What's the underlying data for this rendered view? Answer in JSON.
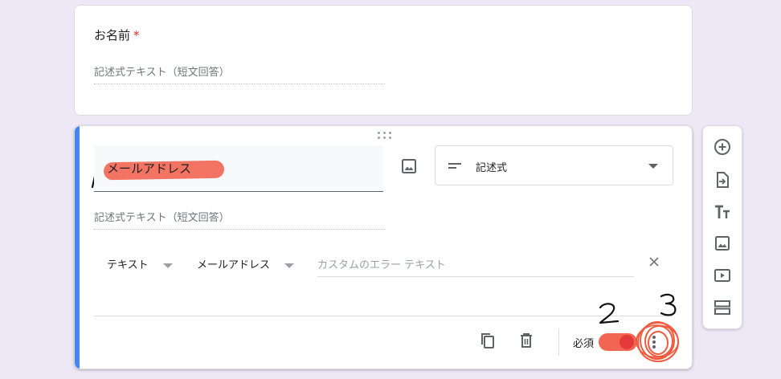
{
  "question1": {
    "title": "お名前",
    "required_mark": "*",
    "answer_placeholder": "記述式テキスト（短文回答）"
  },
  "question2": {
    "title": "メールアドレス",
    "answer_placeholder": "記述式テキスト（短文回答）",
    "type_select": {
      "value": "記述式",
      "icon": "short-text-icon"
    },
    "validation": {
      "type": "テキスト",
      "condition": "メールアドレス",
      "error_placeholder": "カスタムのエラー テキスト"
    },
    "footer": {
      "required_label": "必須",
      "required_on": true
    }
  },
  "annotations": {
    "one": "1",
    "two": "2",
    "three": "3",
    "color": "#f26552"
  },
  "side_toolbar": {
    "items": [
      "add-question-icon",
      "import-questions-icon",
      "add-title-icon",
      "add-image-icon",
      "add-video-icon",
      "add-section-icon"
    ]
  },
  "colors": {
    "accent": "#4285f4",
    "background": "#ede7f6",
    "required_star": "#d93025"
  }
}
